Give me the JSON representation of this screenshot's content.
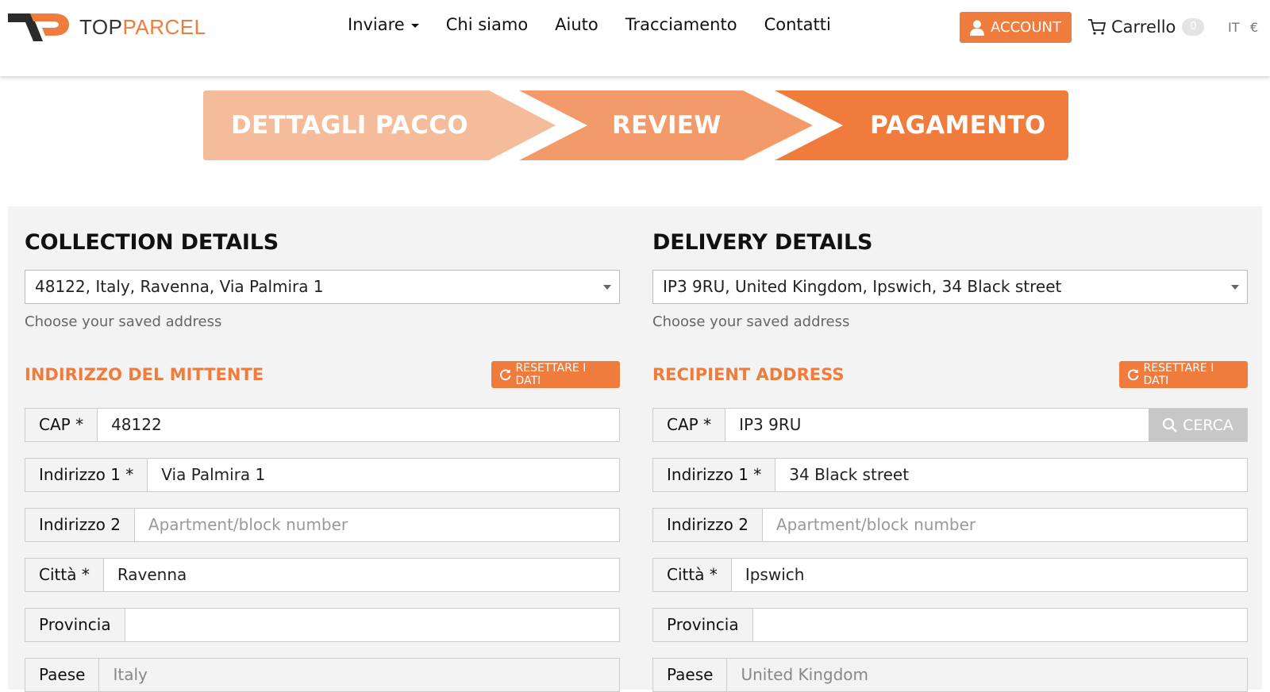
{
  "header": {
    "logo_top": "TOP",
    "logo_parcel": "PARCEL",
    "nav": [
      "Inviare",
      "Chi siamo",
      "Aiuto",
      "Tracciamento",
      "Contatti"
    ],
    "account_label": "ACCOUNT",
    "cart_label": "Carrello",
    "cart_count": "0",
    "language": "IT",
    "currency": "€"
  },
  "steps": [
    "DETTAGLI PACCO",
    "REVIEW",
    "PAGAMENTO"
  ],
  "collection": {
    "title": "COLLECTION DETAILS",
    "saved_address": "48122, Italy, Ravenna, Via Palmira 1",
    "help": "Choose your saved address",
    "section_title": "INDIRIZZO DEL MITTENTE",
    "reset_label": "RESETTARE I DATI",
    "fields": {
      "cap_label": "CAP *",
      "cap_value": "48122",
      "addr1_label": "Indirizzo 1 *",
      "addr1_value": "Via Palmira 1",
      "addr2_label": "Indirizzo 2",
      "addr2_placeholder": "Apartment/block number",
      "city_label": "Città *",
      "city_value": "Ravenna",
      "province_label": "Provincia",
      "province_value": "",
      "country_label": "Paese",
      "country_value": "Italy"
    }
  },
  "delivery": {
    "title": "DELIVERY DETAILS",
    "saved_address": "IP3 9RU, United Kingdom, Ipswich, 34 Black street",
    "help": "Choose your saved address",
    "section_title": "RECIPIENT ADDRESS",
    "reset_label": "RESETTARE I DATI",
    "search_label": "CERCA",
    "fields": {
      "cap_label": "CAP *",
      "cap_value": "IP3 9RU",
      "addr1_label": "Indirizzo 1 *",
      "addr1_value": "34 Black street",
      "addr2_label": "Indirizzo 2",
      "addr2_placeholder": "Apartment/block number",
      "city_label": "Città *",
      "city_value": "Ipswich",
      "province_label": "Provincia",
      "province_value": "",
      "country_label": "Paese",
      "country_value": "United Kingdom"
    }
  },
  "colors": {
    "accent": "#ef7b3d",
    "step1": "#f5bc9c",
    "step2": "#f29a69",
    "step3": "#ef7b3d"
  }
}
